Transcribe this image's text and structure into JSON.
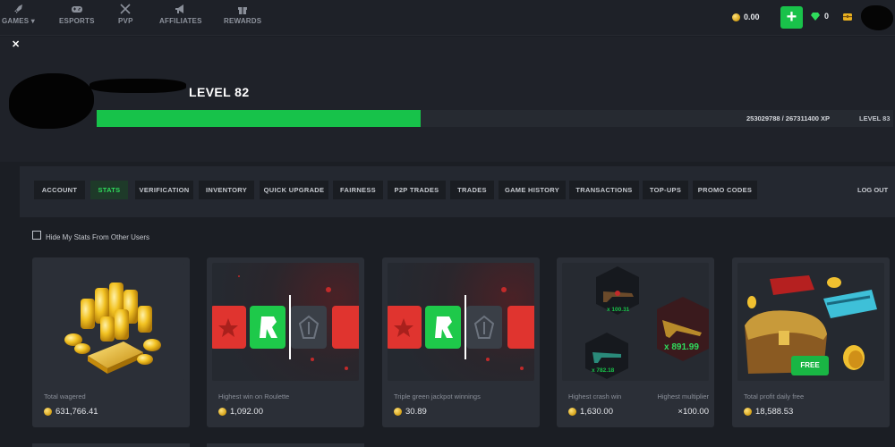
{
  "nav": {
    "items": [
      {
        "label": "GAMES",
        "icon": "rocket-icon"
      },
      {
        "label": "ESPORTS",
        "icon": "gamepad-icon"
      },
      {
        "label": "PVP",
        "icon": "crossed-swords-icon"
      },
      {
        "label": "AFFILIATES",
        "icon": "megaphone-icon"
      },
      {
        "label": "REWARDS",
        "icon": "gift-icon"
      }
    ],
    "games_caret": "▾"
  },
  "wallet": {
    "balance": "0.00",
    "add_label": "+",
    "gems": "0"
  },
  "profile": {
    "close": "✕",
    "level_title": "LEVEL 82",
    "xp_text": "253029788 / 267311400 XP",
    "next_level": "LEVEL 83",
    "xp_progress": 0.407
  },
  "tabs": [
    {
      "label": "ACCOUNT",
      "active": false
    },
    {
      "label": "STATS",
      "active": true
    },
    {
      "label": "VERIFICATION",
      "active": false
    },
    {
      "label": "INVENTORY",
      "active": false
    },
    {
      "label": "QUICK UPGRADE",
      "active": false
    },
    {
      "label": "FAIRNESS",
      "active": false
    },
    {
      "label": "P2P TRADES",
      "active": false
    },
    {
      "label": "TRADES",
      "active": false
    },
    {
      "label": "GAME HISTORY",
      "active": false
    },
    {
      "label": "TRANSACTIONS",
      "active": false
    },
    {
      "label": "TOP-UPS",
      "active": false
    },
    {
      "label": "PROMO CODES",
      "active": false
    }
  ],
  "logout_label": "LOG OUT",
  "hide_stats_label": "Hide My Stats From Other Users",
  "stats": {
    "total_wagered": {
      "title": "Total wagered",
      "value": "631,766.41"
    },
    "highest_roulette": {
      "title": "Highest win on Roulette",
      "value": "1,092.00"
    },
    "triple_green": {
      "title": "Triple green jackpot winnings",
      "value": "30.89"
    },
    "crash": {
      "title": "Highest crash win",
      "value": "1,630.00",
      "title2": "Highest multiplier",
      "value2": "×100.00",
      "hex_small_1": "x 100.31",
      "hex_big": "x 891.99",
      "hex_small_2": "x 782.18"
    },
    "daily_free": {
      "title": "Total profit daily free",
      "value": "18,588.53",
      "badge": "FREE"
    }
  },
  "colors": {
    "accent_green": "#19c24a",
    "roulette_red": "#e0342f",
    "bg": "#1b1e24",
    "card": "#2b2f37"
  }
}
